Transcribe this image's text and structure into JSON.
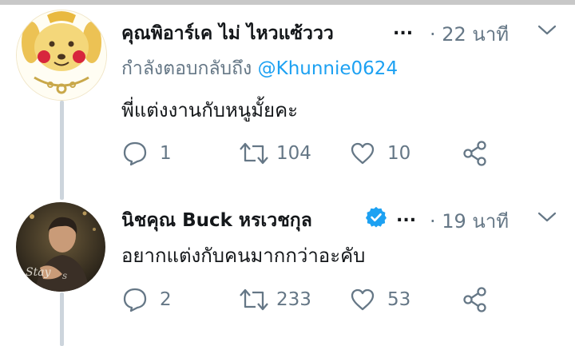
{
  "tweets": [
    {
      "name": "คุณพิอาร์เค ไม่ ไหวแซ้ววว",
      "ellipsis": "...",
      "time": "· 22 นาที",
      "reply_prefix": "กำลังตอบกลับถึง",
      "reply_handle": "@Khunnie0624",
      "text": "พี่แต่งงานกับหนูมั้ยคะ",
      "replies": "1",
      "retweets": "104",
      "likes": "10",
      "verified": false
    },
    {
      "name": "นิชคุณ Buck หรเวชกุล",
      "ellipsis": "...",
      "time": "· 19 นาที",
      "text": "อยากแต่งกับคนมากกว่าอะคับ",
      "replies": "2",
      "retweets": "233",
      "likes": "53",
      "verified": true
    }
  ],
  "colors": {
    "text": "#14171a",
    "secondary": "#657786",
    "link": "#1da1f2",
    "thread_line": "#cdd5dc"
  },
  "icons": [
    "reply-icon",
    "retweet-icon",
    "like-icon",
    "share-icon",
    "chevron-down-icon",
    "verified-badge-icon"
  ]
}
